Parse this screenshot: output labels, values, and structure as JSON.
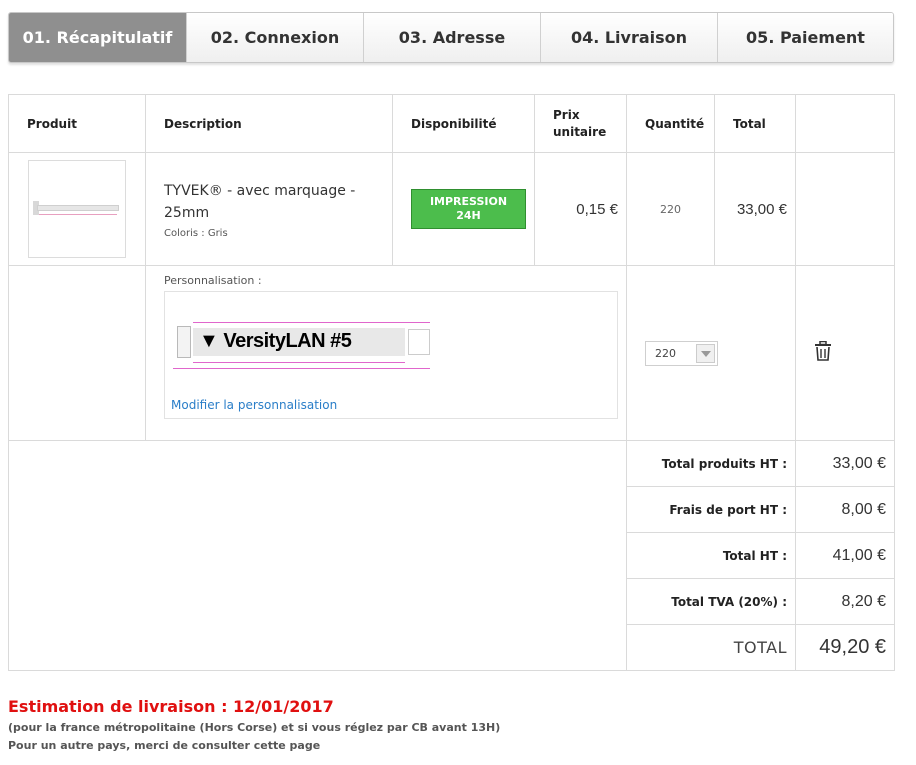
{
  "steps": [
    {
      "label": "01. Récapitulatif",
      "active": true
    },
    {
      "label": "02. Connexion",
      "active": false
    },
    {
      "label": "03. Adresse",
      "active": false
    },
    {
      "label": "04. Livraison",
      "active": false
    },
    {
      "label": "05. Paiement",
      "active": false
    }
  ],
  "table": {
    "headers": {
      "produit": "Produit",
      "description": "Description",
      "disponibilite": "Disponibilité",
      "prix_line1": "Prix",
      "prix_line2": "unitaire",
      "quantite": "Quantité",
      "total": "Total"
    }
  },
  "product": {
    "title": "TYVEK® - avec marquage - 25mm",
    "color_text": "Coloris : Gris",
    "availability_line1": "IMPRESSION",
    "availability_line2": "24H",
    "unit_price": "0,15 €",
    "quantity": "220",
    "total": "33,00 €"
  },
  "personalisation": {
    "label": "Personnalisation :",
    "preview_text": "▼ VersityLAN #5",
    "modify_link": "Modifier la personnalisation",
    "quantity_selected": "220"
  },
  "summary": [
    {
      "label": "Total produits HT :",
      "value": "33,00 €"
    },
    {
      "label": "Frais de port HT :",
      "value": "8,00 €"
    },
    {
      "label": "Total HT :",
      "value": "41,00 €"
    },
    {
      "label": "Total TVA (20%) :",
      "value": "8,20 €"
    }
  ],
  "grand_total": {
    "label": "TOTAL",
    "value": "49,20 €"
  },
  "delivery": {
    "estimate": "Estimation de livraison : 12/01/2017",
    "note1": "(pour la france métropolitaine (Hors Corse) et si vous réglez par CB avant 13H)",
    "note2": "Pour un autre pays, merci de consulter cette page"
  },
  "colors": {
    "active_step": "#8f8f8f",
    "badge_green": "#4cbd4c",
    "delivery_red": "#e01010",
    "link_blue": "#2a7ec8"
  },
  "icons": [
    "trash-icon",
    "chevron-down-icon"
  ]
}
